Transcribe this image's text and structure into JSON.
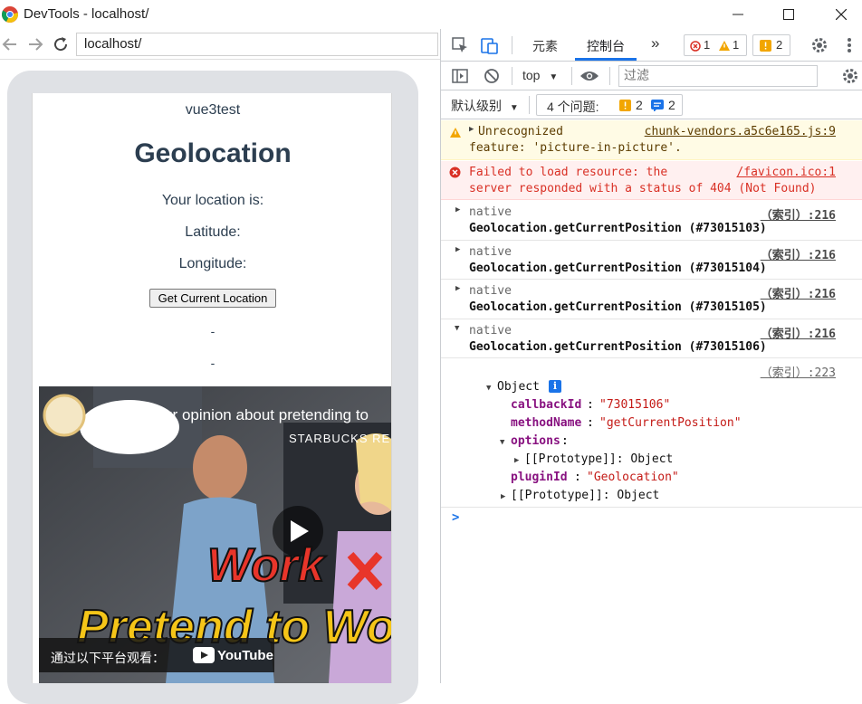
{
  "window": {
    "title": "DevTools - localhost/"
  },
  "browser": {
    "url": "localhost/"
  },
  "app": {
    "name": "vue3test",
    "heading": "Geolocation",
    "location_label": "Your location is:",
    "latitude_label": "Latitude:",
    "longitude_label": "Longitude:",
    "button_label": "Get Current Location",
    "dash1": "-",
    "dash2": "-"
  },
  "video": {
    "title": "What's your opinion about pretending to",
    "caption_big1": "Work",
    "caption_big2": "Pretend to Wo",
    "watch_on": "通过以下平台观看：",
    "youtube": "YouTube",
    "starbucks": "STARBUCKS RES"
  },
  "devtools": {
    "tabs": {
      "elements": "元素",
      "console": "控制台",
      "more": "»"
    },
    "error_count": "1",
    "warning_count": "1",
    "issue_count": "2",
    "context": "top",
    "filter_placeholder": "过滤",
    "levels_label": "默认级别",
    "issues_label": "4 个问题:",
    "issues_warn": "2",
    "issues_info": "2",
    "logs": [
      {
        "type": "warning",
        "line1": "Unrecognized",
        "line2": "feature: 'picture-in-picture'.",
        "source": "chunk-vendors.a5c6e165.js:9"
      },
      {
        "type": "error",
        "line1": "Failed to load resource: the",
        "line2": "server responded with a status of 404 (Not Found)",
        "source": "/favicon.ico:1"
      },
      {
        "type": "log",
        "line1": "native",
        "line2": "Geolocation.getCurrentPosition (#73015103)",
        "source": "（索引）:216"
      },
      {
        "type": "log",
        "line1": "native",
        "line2": "Geolocation.getCurrentPosition (#73015104)",
        "source": "（索引）:216"
      },
      {
        "type": "log",
        "line1": "native",
        "line2": "Geolocation.getCurrentPosition (#73015105)",
        "source": "（索引）:216"
      },
      {
        "type": "log",
        "line1": "native",
        "line2": "Geolocation.getCurrentPosition (#73015106)",
        "source": "（索引）:216"
      }
    ],
    "object_source": "（索引）:223",
    "object": {
      "label": "Object",
      "callbackId_key": "callbackId",
      "callbackId_val": "\"73015106\"",
      "methodName_key": "methodName",
      "methodName_val": "\"getCurrentPosition\"",
      "options_key": "options",
      "proto_inner": "[[Prototype]]: Object",
      "pluginId_key": "pluginId",
      "pluginId_val": "\"Geolocation\"",
      "proto_outer": "[[Prototype]]: Object"
    },
    "prompt": ">"
  }
}
